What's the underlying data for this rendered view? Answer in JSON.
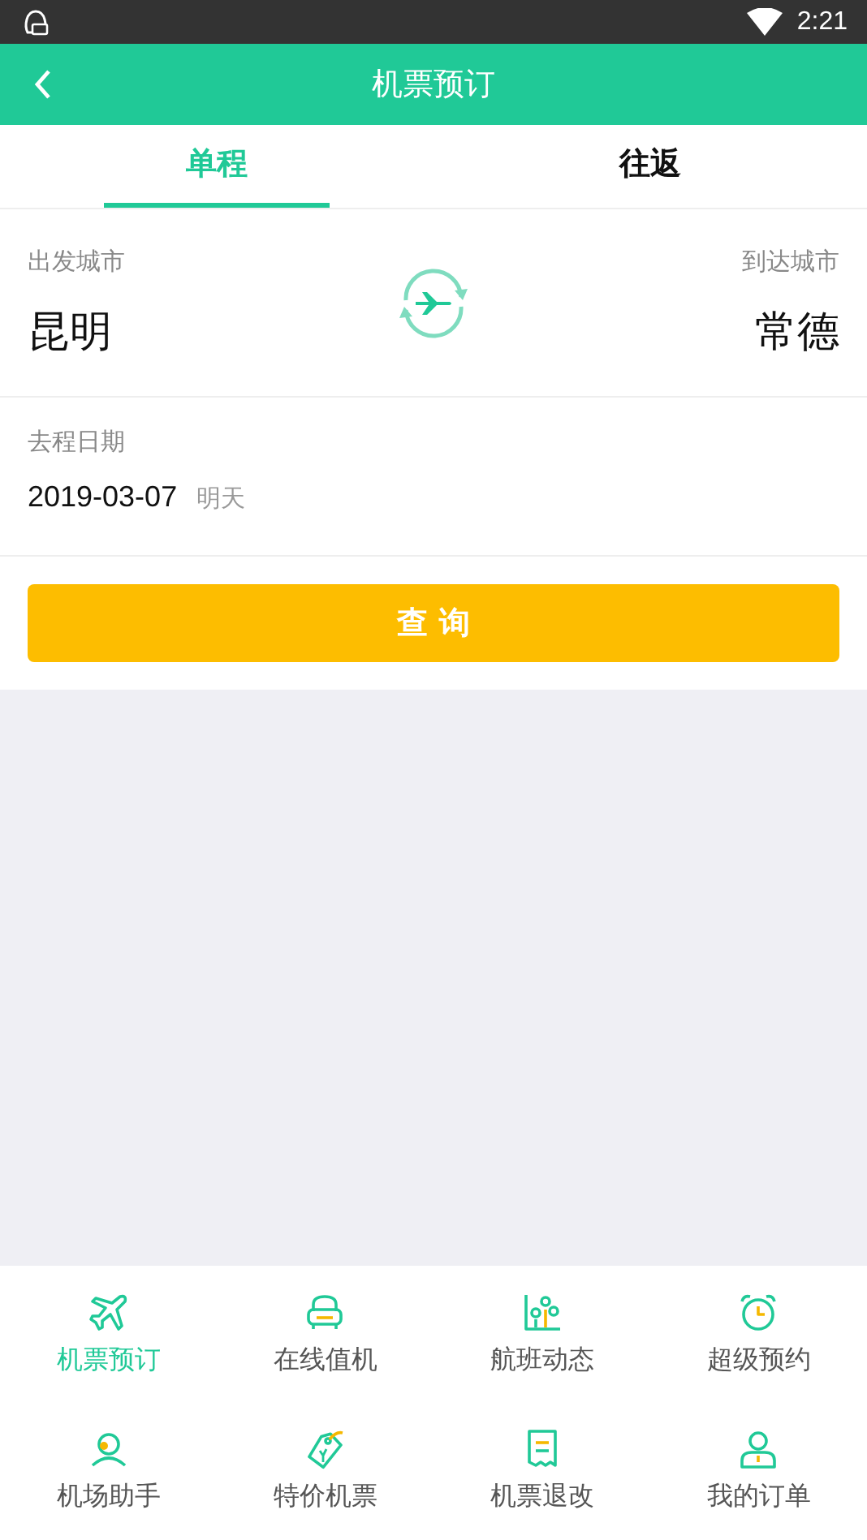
{
  "status_bar": {
    "time": "2:21"
  },
  "header": {
    "title": "机票预订"
  },
  "tabs": [
    {
      "label": "单程",
      "selected": true
    },
    {
      "label": "往返",
      "selected": false
    }
  ],
  "route": {
    "from_label": "出发城市",
    "from_city": "昆明",
    "to_label": "到达城市",
    "to_city": "常德"
  },
  "date": {
    "label": "去程日期",
    "value": "2019-03-07",
    "note": "明天"
  },
  "search_button": "查 询",
  "menu": [
    {
      "label": "机票预订",
      "kind": "plane",
      "selected": true
    },
    {
      "label": "在线值机",
      "kind": "seat",
      "selected": false
    },
    {
      "label": "航班动态",
      "kind": "chart",
      "selected": false
    },
    {
      "label": "超级预约",
      "kind": "alarm",
      "selected": false
    },
    {
      "label": "机场助手",
      "kind": "assistant",
      "selected": false
    },
    {
      "label": "特价机票",
      "kind": "tag",
      "selected": false
    },
    {
      "label": "机票退改",
      "kind": "receipt",
      "selected": false
    },
    {
      "label": "我的订单",
      "kind": "person",
      "selected": false
    }
  ]
}
